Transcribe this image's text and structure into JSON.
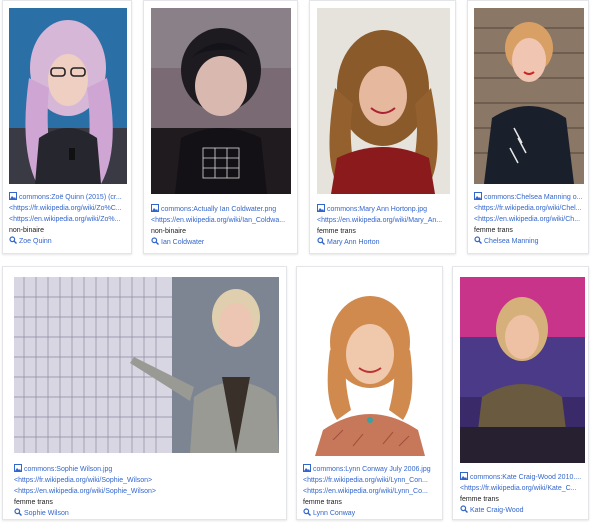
{
  "cards": [
    {
      "file": "commons:Zoë Quinn (2015) (cr...",
      "urls": [
        "<https://fr.wikipedia.org/wiki/Zo%C...",
        "<https://en.wikipedia.org/wiki/Zo%..."
      ],
      "gender": "non-binaire",
      "name": "Zoe Quinn"
    },
    {
      "file": "commons:Actually Ian Coldwater.png",
      "urls": [
        "<https://en.wikipedia.org/wiki/Ian_Coldwa..."
      ],
      "gender": "non-binaire",
      "name": "Ian Coldwater"
    },
    {
      "file": "commons:Mary Ann Hortonp.jpg",
      "urls": [
        "<https://en.wikipedia.org/wiki/Mary_An..."
      ],
      "gender": "femme trans",
      "name": "Mary Ann Horton"
    },
    {
      "file": "commons:Chelsea Manning o...",
      "urls": [
        "<https://fr.wikipedia.org/wiki/Chel...",
        "<https://en.wikipedia.org/wiki/Ch..."
      ],
      "gender": "femme trans",
      "name": "Chelsea Manning"
    },
    {
      "file": "commons:Sophie Wilson.jpg",
      "urls": [
        "<https://fr.wikipedia.org/wiki/Sophie_Wilson>",
        "<https://en.wikipedia.org/wiki/Sophie_Wilson>"
      ],
      "gender": "femme trans",
      "name": "Sophie Wilson"
    },
    {
      "file": "commons:Lynn Conway July 2006.jpg",
      "urls": [
        "<https://fr.wikipedia.org/wiki/Lynn_Con...",
        "<https://en.wikipedia.org/wiki/Lynn_Co..."
      ],
      "gender": "femme trans",
      "name": "Lynn Conway"
    },
    {
      "file": "commons:Kate Craig-Wood 2010....",
      "urls": [
        "<https://fr.wikipedia.org/wiki/Kate_C..."
      ],
      "gender": "femme trans",
      "name": "Kate Craig-Wood"
    }
  ],
  "icons": {
    "file": "image-icon",
    "search": "magnifier-icon"
  },
  "colors": {
    "link": "#3366cc",
    "text": "#202122",
    "border": "#e3e5e8"
  }
}
